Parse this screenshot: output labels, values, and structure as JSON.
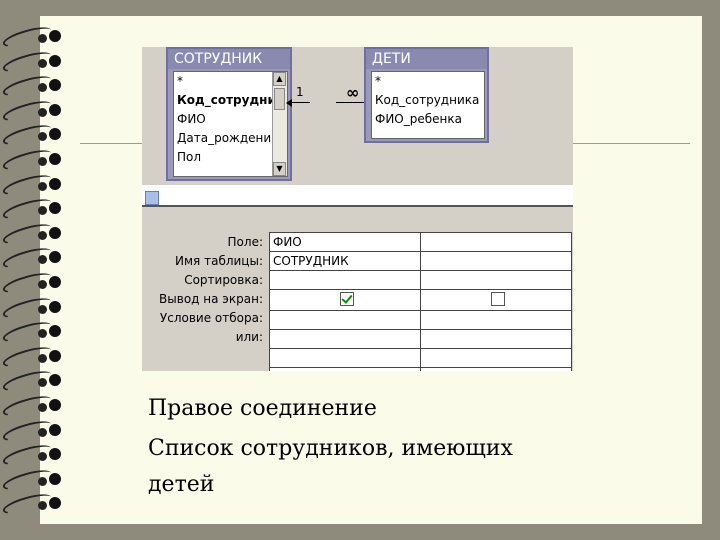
{
  "tables": {
    "left": {
      "title": "СОТРУДНИК",
      "fields": [
        "*",
        "Код_сотрудник",
        "ФИО",
        "Дата_рождени",
        "Пол"
      ]
    },
    "right": {
      "title": "ДЕТИ",
      "fields": [
        "*",
        "Код_сотрудника",
        "ФИО_ребенка"
      ]
    },
    "relation": {
      "one": "1",
      "many": "∞"
    }
  },
  "grid": {
    "row_labels": [
      "Поле:",
      "Имя таблицы:",
      "Сортировка:",
      "Вывод на экран:",
      "Условие отбора:",
      "или:"
    ],
    "col1": {
      "field": "ФИО",
      "table": "СОТРУДНИК",
      "show": true
    },
    "col2": {
      "field": "",
      "table": "",
      "show": false
    }
  },
  "caption": {
    "line1": "Правое соединение",
    "line2": "Список сотрудников, имеющих",
    "line3": "детей"
  },
  "colors": {
    "page": "#fbfbea",
    "background": "#8e8a7c",
    "table_header": "#8a8ab0",
    "check": "#0a8a0a"
  }
}
